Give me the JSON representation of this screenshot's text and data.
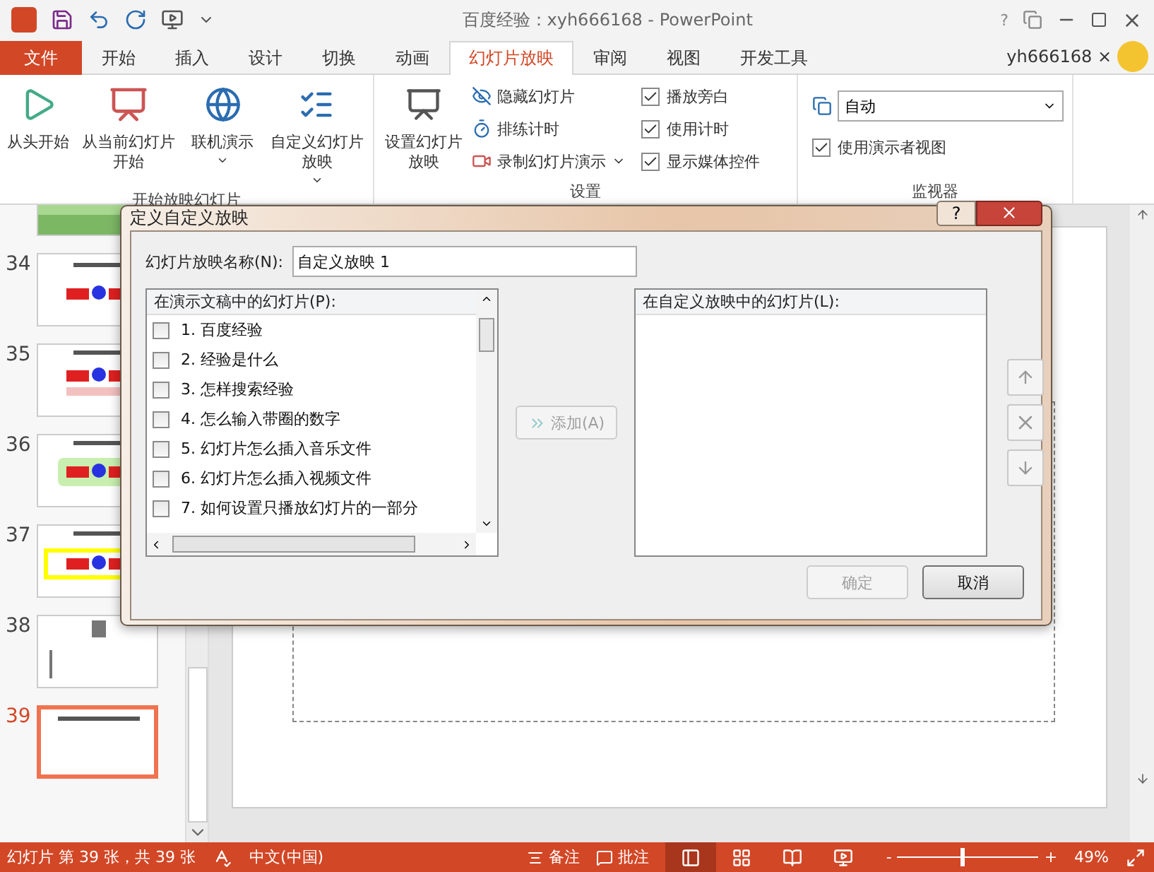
{
  "window": {
    "title": "百度经验：xyh666168 - PowerPoint",
    "help": "?"
  },
  "tabs": [
    {
      "label": "文件",
      "kind": "file",
      "selected": false
    },
    {
      "label": "开始",
      "kind": "tab",
      "selected": false
    },
    {
      "label": "插入",
      "kind": "tab",
      "selected": false
    },
    {
      "label": "设计",
      "kind": "tab",
      "selected": false
    },
    {
      "label": "切换",
      "kind": "tab",
      "selected": false
    },
    {
      "label": "动画",
      "kind": "tab",
      "selected": false
    },
    {
      "label": "幻灯片放映",
      "kind": "tab",
      "selected": true
    },
    {
      "label": "审阅",
      "kind": "tab",
      "selected": false
    },
    {
      "label": "视图",
      "kind": "tab",
      "selected": false
    },
    {
      "label": "开发工具",
      "kind": "tab",
      "selected": false
    }
  ],
  "user": "yh666168 ×",
  "ribbon": {
    "start_group": {
      "label": "开始放映幻灯片",
      "buttons": [
        {
          "label": "从头开始",
          "kind": "play",
          "dropdown": false
        },
        {
          "label": "从当前幻灯片开始",
          "kind": "current",
          "dropdown": false
        },
        {
          "label": "联机演示",
          "kind": "online",
          "dropdown": true
        },
        {
          "label": "自定义幻灯片放映",
          "kind": "custom",
          "dropdown": true
        }
      ]
    },
    "setup_group": {
      "label": "设置",
      "big": "设置幻灯片放映",
      "small": [
        {
          "label": "隐藏幻灯片",
          "kind": "hide",
          "dropdown": false
        },
        {
          "label": "排练计时",
          "kind": "timer",
          "dropdown": false
        },
        {
          "label": "录制幻灯片演示",
          "kind": "record",
          "dropdown": true
        }
      ],
      "checks": [
        {
          "label": "播放旁白",
          "checked": true
        },
        {
          "label": "使用计时",
          "checked": true
        },
        {
          "label": "显示媒体控件",
          "checked": true
        }
      ]
    },
    "monitor_group": {
      "label": "监视器",
      "monitor": "自动",
      "presenter_view": {
        "label": "使用演示者视图",
        "checked": true
      }
    }
  },
  "slides": [
    {
      "kind": "partial",
      "selected": false
    },
    {
      "number": "34",
      "kind": "logo",
      "selected": false
    },
    {
      "number": "35",
      "kind": "reflect",
      "selected": false
    },
    {
      "number": "36",
      "kind": "glow",
      "selected": false
    },
    {
      "number": "37",
      "kind": "frame",
      "selected": false
    },
    {
      "number": "38",
      "kind": "text",
      "selected": false
    },
    {
      "number": "39",
      "kind": "blank",
      "selected": true
    }
  ],
  "dialog": {
    "title": "定义自定义放映",
    "name_label": "幻灯片放映名称(N):",
    "name_value": "自定义放映 1",
    "left_header": "在演示文稿中的幻灯片(P):",
    "left_items": [
      {
        "label": "1. 百度经验",
        "checked": false
      },
      {
        "label": "2. 经验是什么",
        "checked": false
      },
      {
        "label": "3.  怎样搜索经验",
        "checked": false
      },
      {
        "label": "4. 怎么输入带圈的数字",
        "checked": false
      },
      {
        "label": "5. 幻灯片怎么插入音乐文件",
        "checked": false
      },
      {
        "label": "6. 幻灯片怎么插入视频文件",
        "checked": false
      },
      {
        "label": "7. 如何设置只播放幻灯片的一部分",
        "checked": false
      }
    ],
    "add_button": {
      "label": "添加(A)",
      "disabled": true
    },
    "right_header": "在自定义放映中的幻灯片(L):",
    "side_buttons": [
      {
        "kind": "up",
        "disabled": true
      },
      {
        "kind": "delete",
        "disabled": true
      },
      {
        "kind": "down",
        "disabled": true
      }
    ],
    "ok": {
      "label": "确定",
      "disabled": true
    },
    "cancel": {
      "label": "取消",
      "disabled": false
    }
  },
  "status": {
    "slide_info": "幻灯片 第 39 张，共 39 张",
    "language": "中文(中国)",
    "notes": "备注",
    "comments": "批注",
    "views": [
      {
        "kind": "normal",
        "selected": true
      },
      {
        "kind": "sorter",
        "selected": false
      },
      {
        "kind": "reading",
        "selected": false
      },
      {
        "kind": "show",
        "selected": false
      }
    ],
    "zoom": {
      "level": 0.45,
      "minus": "-",
      "plus": "+",
      "reading": "49%"
    }
  }
}
